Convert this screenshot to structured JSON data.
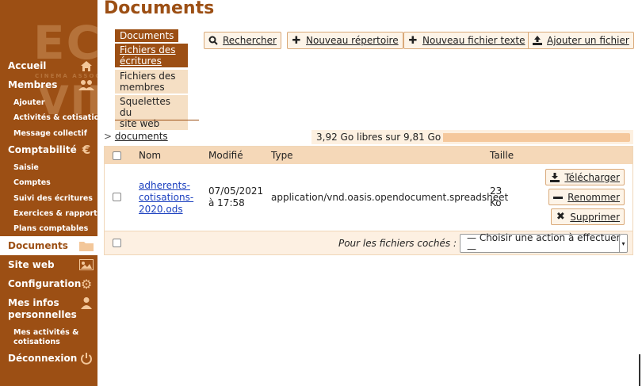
{
  "logo": {
    "line1": "ECRAN",
    "line2": "CINEMA ASSOCIATIF",
    "line3": "VILLE"
  },
  "sidebar": {
    "accueil": "Accueil",
    "membres": "Membres",
    "ajouter": "Ajouter",
    "activites": "Activités & cotisations",
    "message": "Message collectif",
    "comptabilite": "Comptabilité",
    "saisie": "Saisie",
    "comptes": "Comptes",
    "suivi": "Suivi des écritures",
    "exercices": "Exercices & rapports",
    "plans": "Plans comptables",
    "documents": "Documents",
    "siteweb": "Site web",
    "configuration": "Configuration",
    "mesinfos1": "Mes infos",
    "mesinfos2": "personnelles",
    "mesactivites1": "Mes activités &",
    "mesactivites2": "cotisations",
    "deconnexion": "Déconnexion"
  },
  "page": {
    "title": "Documents"
  },
  "subtabs": {
    "documents": "Documents",
    "ecritures1": "Fichiers des",
    "ecritures2": "écritures",
    "membres1": "Fichiers des",
    "membres2": "membres",
    "squelettes1": "Squelettes du",
    "squelettes2": "site web"
  },
  "toolbar": {
    "rechercher": "Rechercher",
    "nouveau_repertoire": "Nouveau répertoire",
    "nouveau_fichier": "Nouveau fichier texte",
    "ajouter_fichier": "Ajouter un fichier"
  },
  "breadcrumb": {
    "sep": ">",
    "current": "documents"
  },
  "quota": {
    "text": "3,92 Go libres sur 9,81 Go",
    "used_fraction": 0.6
  },
  "table": {
    "headers": {
      "nom": "Nom",
      "modifie": "Modifié",
      "type": "Type",
      "taille": "Taille"
    },
    "row": {
      "name1": "adherents-",
      "name2": "cotisations-",
      "name3": "2020.ods",
      "date1": "07/05/2021",
      "date2": "à 17:58",
      "type": "application/vnd.oasis.opendocument.spreadsheet",
      "size1": "23",
      "size2": "Ko",
      "telecharger": "Télécharger",
      "renommer": "Renommer",
      "supprimer": "Supprimer"
    },
    "footer": {
      "label": "Pour les fichiers cochés :",
      "select": "— Choisir une action à effectuer —"
    }
  },
  "colors": {
    "brand": "#9c4f14",
    "accent_light": "#f5d8b8"
  }
}
